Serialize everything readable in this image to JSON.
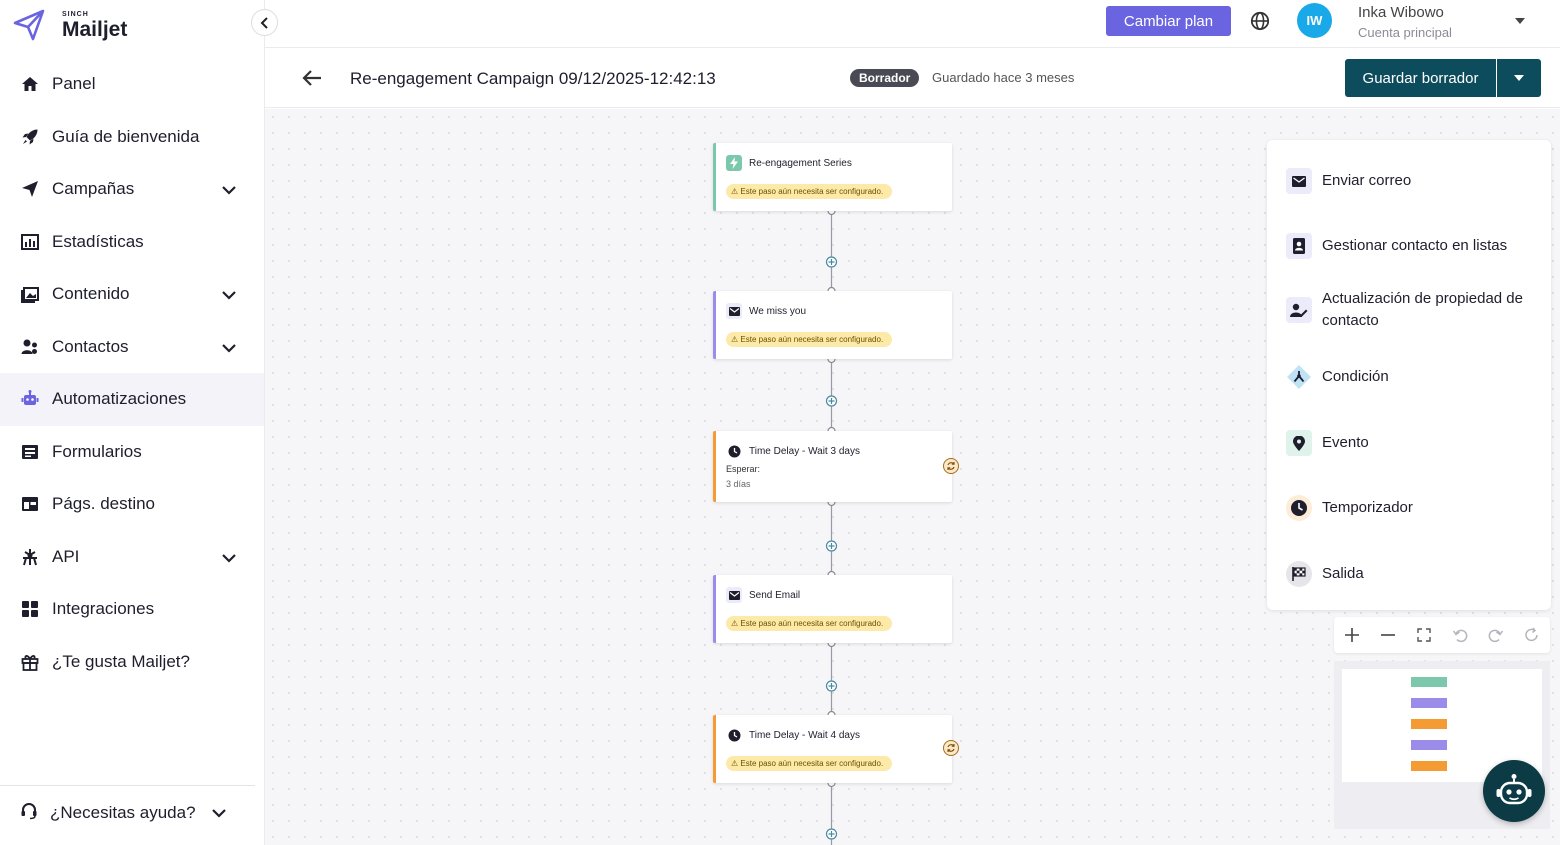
{
  "app": {
    "brand_small": "SINCH",
    "brand_name": "Mailjet"
  },
  "sidebar": {
    "items": [
      {
        "label": "Panel",
        "icon": "home-icon"
      },
      {
        "label": "Guía de bienvenida",
        "icon": "rocket-icon"
      },
      {
        "label": "Campañas",
        "icon": "send-icon",
        "expandable": true
      },
      {
        "label": "Estadísticas",
        "icon": "chart-icon"
      },
      {
        "label": "Contenido",
        "icon": "image-icon",
        "expandable": true
      },
      {
        "label": "Contactos",
        "icon": "contacts-icon",
        "expandable": true
      },
      {
        "label": "Automatizaciones",
        "icon": "robot-icon",
        "active": true
      },
      {
        "label": "Formularios",
        "icon": "form-icon"
      },
      {
        "label": "Págs. destino",
        "icon": "landing-page-icon"
      },
      {
        "label": "API",
        "icon": "api-icon",
        "expandable": true
      },
      {
        "label": "Integraciones",
        "icon": "grid-icon"
      },
      {
        "label": "¿Te gusta Mailjet?",
        "icon": "gift-icon"
      }
    ],
    "help_label": "¿Necesitas ayuda?"
  },
  "topbar": {
    "upgrade_label": "Cambiar plan",
    "avatar_initials": "IW",
    "user_name": "Inka Wibowo",
    "user_account": "Cuenta principal"
  },
  "header": {
    "title": "Re-engagement Campaign 09/12/2025-12:42:13",
    "status": "Borrador",
    "saved_text": "Guardado hace 3 meses",
    "save_label": "Guardar borrador"
  },
  "flow": {
    "warning_text": "Este paso aún necesita ser configurado.",
    "nodes": [
      {
        "name": "Re-engagement Series",
        "type": "trigger"
      },
      {
        "name": "We miss you",
        "type": "email"
      },
      {
        "name": "Time Delay - Wait 3 days",
        "type": "delay",
        "wait_label": "Esperar:",
        "wait_value": "3 días"
      },
      {
        "name": "Send Email",
        "type": "email"
      },
      {
        "name": "Time Delay - Wait 4 days",
        "type": "delay"
      }
    ]
  },
  "actions": {
    "items": [
      {
        "label": "Enviar correo",
        "icon": "mail-icon"
      },
      {
        "label": "Gestionar contacto en listas",
        "icon": "contact-list-icon"
      },
      {
        "label": "Actualización de propiedad de contacto",
        "icon": "contact-edit-icon"
      },
      {
        "label": "Condición",
        "icon": "condition-icon"
      },
      {
        "label": "Evento",
        "icon": "event-pin-icon"
      },
      {
        "label": "Temporizador",
        "icon": "clock-icon"
      },
      {
        "label": "Salida",
        "icon": "exit-flag-icon"
      }
    ]
  },
  "colors": {
    "accent": "#6a64e0",
    "primary_dark": "#0d4c5d",
    "trigger": "#7cc8ad",
    "email": "#9b8cea",
    "delay": "#f59b33",
    "warning_bg": "#fde9a8"
  }
}
